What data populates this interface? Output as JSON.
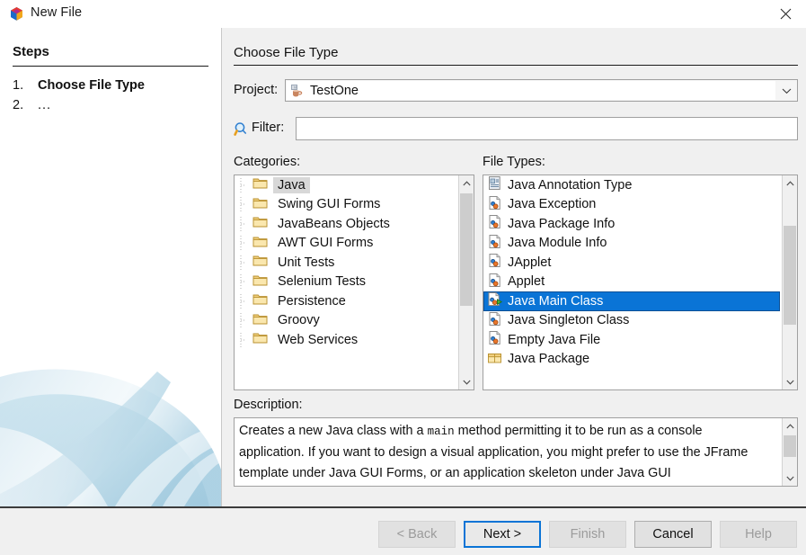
{
  "window": {
    "title": "New File",
    "icon": "netbeans-logo-icon",
    "close_icon": "close-icon"
  },
  "steps": {
    "heading": "Steps",
    "items": [
      {
        "number": "1.",
        "label": "Choose File Type"
      },
      {
        "number": "2.",
        "label": "..."
      }
    ]
  },
  "panel": {
    "title": "Choose File Type"
  },
  "project": {
    "label": "Project:",
    "value": "TestOne",
    "icon": "java-coffee-cup-icon",
    "dropdown_icon": "chevron-down-icon"
  },
  "filter": {
    "icon": "search-icon",
    "label": "Filter:",
    "value": "",
    "placeholder": ""
  },
  "categories": {
    "label": "Categories:",
    "items": [
      {
        "label": "Java",
        "icon": "folder-icon",
        "selected": true
      },
      {
        "label": "Swing GUI Forms",
        "icon": "folder-icon",
        "selected": false
      },
      {
        "label": "JavaBeans Objects",
        "icon": "folder-icon",
        "selected": false
      },
      {
        "label": "AWT GUI Forms",
        "icon": "folder-icon",
        "selected": false
      },
      {
        "label": "Unit Tests",
        "icon": "folder-icon",
        "selected": false
      },
      {
        "label": "Selenium Tests",
        "icon": "folder-icon",
        "selected": false
      },
      {
        "label": "Persistence",
        "icon": "folder-icon",
        "selected": false
      },
      {
        "label": "Groovy",
        "icon": "folder-icon",
        "selected": false
      },
      {
        "label": "Web Services",
        "icon": "folder-icon",
        "selected": false
      }
    ]
  },
  "file_types": {
    "label": "File Types:",
    "items": [
      {
        "label": "Java Annotation Type",
        "icon": "java-annotation-file-icon",
        "selected": false
      },
      {
        "label": "Java Exception",
        "icon": "java-class-file-icon",
        "selected": false
      },
      {
        "label": "Java Package Info",
        "icon": "java-class-file-icon",
        "selected": false
      },
      {
        "label": "Java Module Info",
        "icon": "java-class-file-icon",
        "selected": false
      },
      {
        "label": "JApplet",
        "icon": "java-class-file-icon",
        "selected": false
      },
      {
        "label": "Applet",
        "icon": "java-class-file-icon",
        "selected": false
      },
      {
        "label": "Java Main Class",
        "icon": "java-main-class-file-icon",
        "selected": true
      },
      {
        "label": "Java Singleton Class",
        "icon": "java-class-file-icon",
        "selected": false
      },
      {
        "label": "Empty Java File",
        "icon": "java-class-file-icon",
        "selected": false
      },
      {
        "label": "Java Package",
        "icon": "java-package-icon",
        "selected": false
      }
    ]
  },
  "description": {
    "label": "Description:",
    "text_part_1": "Creates a new Java class with a ",
    "text_mono": "main",
    "text_part_2": " method permitting it to be run as a console application. If you want to design a visual application, you might prefer to use the JFrame template under Java GUI Forms, or an application skeleton under Java GUI"
  },
  "buttons": {
    "back": "< Back",
    "next": "Next >",
    "finish": "Finish",
    "cancel": "Cancel",
    "help": "Help"
  },
  "colors": {
    "selection_blue": "#0a74d6",
    "selection_gray": "#d8d8d8",
    "dialog_bg": "#f0f0f0",
    "panel_bg": "#ffffff",
    "focus_border": "#0a74d6"
  }
}
